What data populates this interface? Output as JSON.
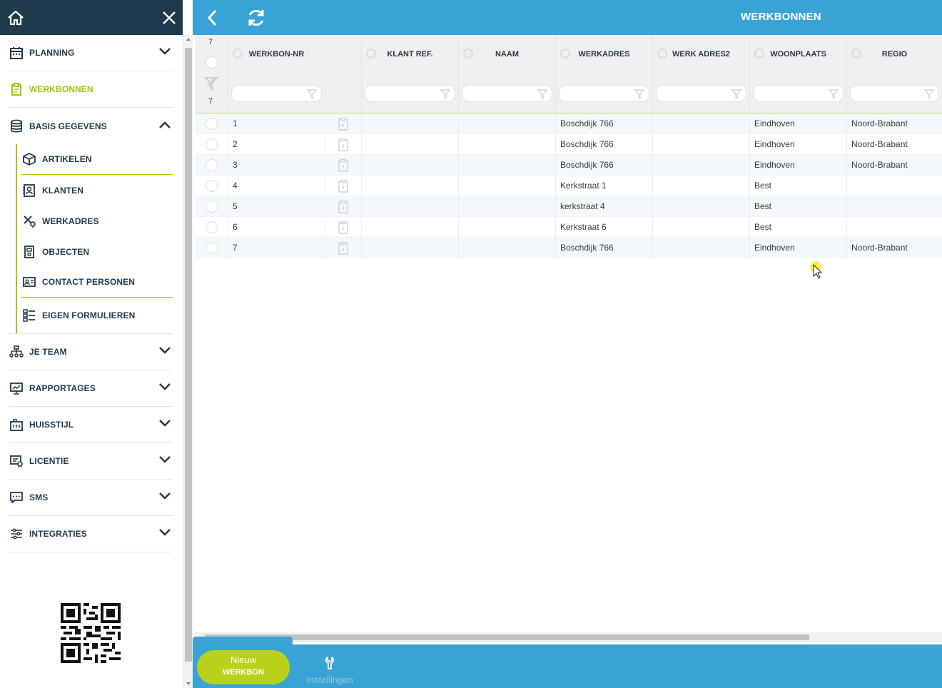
{
  "sidebar": {
    "items": [
      {
        "label": "PLANNING"
      },
      {
        "label": "WERKBONNEN"
      },
      {
        "label": "BASIS GEGEVENS"
      },
      {
        "label": "JE TEAM"
      },
      {
        "label": "RAPPORTAGES"
      },
      {
        "label": "HUISSTIJL"
      },
      {
        "label": "LICENTIE"
      },
      {
        "label": "SMS"
      },
      {
        "label": "INTEGRATIES"
      }
    ],
    "subitems": [
      {
        "label": "ARTIKELEN"
      },
      {
        "label": "KLANTEN"
      },
      {
        "label": "WERKADRES"
      },
      {
        "label": "OBJECTEN"
      },
      {
        "label": "CONTACT PERSONEN"
      },
      {
        "label": "EIGEN FORMULIEREN"
      }
    ],
    "active": "WERKBONNEN"
  },
  "header": {
    "title": "WERKBONNEN"
  },
  "grid": {
    "total_count": "7",
    "filtered_count": "7",
    "columns": [
      "WERKBON-NR",
      "",
      "KLANT REF.",
      "NAAM",
      "WERKADRES",
      "WERK ADRES2",
      "WOONPLAATS",
      "REGIO"
    ],
    "rows": [
      {
        "nr": "1",
        "klant_ref": "",
        "naam": "",
        "werkadres": "Boschdijk 766",
        "werk_adres2": "",
        "woonplaats": "Eindhoven",
        "regio": "Noord-Brabant"
      },
      {
        "nr": "2",
        "klant_ref": "",
        "naam": "",
        "werkadres": "Boschdijk 766",
        "werk_adres2": "",
        "woonplaats": "Eindhoven",
        "regio": "Noord-Brabant"
      },
      {
        "nr": "3",
        "klant_ref": "",
        "naam": "",
        "werkadres": "Boschdijk 766",
        "werk_adres2": "",
        "woonplaats": "Eindhoven",
        "regio": "Noord-Brabant"
      },
      {
        "nr": "4",
        "klant_ref": "",
        "naam": "",
        "werkadres": "Kerkstraat 1",
        "werk_adres2": "",
        "woonplaats": "Best",
        "regio": ""
      },
      {
        "nr": "5",
        "klant_ref": "",
        "naam": "",
        "werkadres": "kerkstraat 4",
        "werk_adres2": "",
        "woonplaats": "Best",
        "regio": ""
      },
      {
        "nr": "6",
        "klant_ref": "",
        "naam": "",
        "werkadres": "Kerkstraat 6",
        "werk_adres2": "",
        "woonplaats": "Best",
        "regio": ""
      },
      {
        "nr": "7",
        "klant_ref": "",
        "naam": "",
        "werkadres": "Boschdijk 766",
        "werk_adres2": "",
        "woonplaats": "Eindhoven",
        "regio": "Noord-Brabant"
      }
    ]
  },
  "footer": {
    "new_button_line1": "Nieuw",
    "new_button_line2": "WERKBON",
    "settings_label": "Instellingen"
  },
  "colors": {
    "sidebar_header": "#1f3a4d",
    "topbar": "#3aa3d6",
    "accent_green": "#a6c400",
    "button_green": "#b8d11b"
  },
  "icons": {
    "home": "home-icon",
    "close": "close-icon",
    "back": "back-arrow-icon",
    "refresh": "refresh-icon",
    "settings": "wrench-icon"
  }
}
